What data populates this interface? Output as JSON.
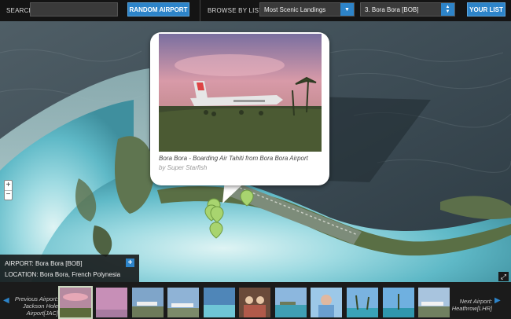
{
  "topbar": {
    "search_label": "SEARCH:",
    "search_value": "",
    "random_button": "RANDOM AIRPORT",
    "browse_label": "BROWSE BY LIST",
    "list_select_value": "Most Scenic Landings",
    "airport_select_value": "3. Bora Bora [BOB]",
    "your_list_button": "YOUR LIST"
  },
  "map": {
    "zoom_in": "+",
    "zoom_out": "−",
    "fullscreen": "⤢"
  },
  "popup": {
    "caption": "Bora Bora - Boarding Air Tahiti from Bora Bora Airport",
    "credit": "by Super Starfish"
  },
  "info": {
    "airport_label": "AIRPORT:",
    "airport_value": "Bora Bora [BOB]",
    "location_label": "LOCATION:",
    "location_value": "Bora Bora, French Polynesia",
    "add_button": "+"
  },
  "strip": {
    "prev_arrow": "◀",
    "next_arrow": "▶",
    "prev_text": "Previous Airport: Jackson Hole Airport[JAC]",
    "next_text": "Next Airport: Heathrow[LHR]"
  },
  "colors": {
    "accent": "#2d84c9",
    "bar": "#141414",
    "pin": "#9fd06a"
  }
}
